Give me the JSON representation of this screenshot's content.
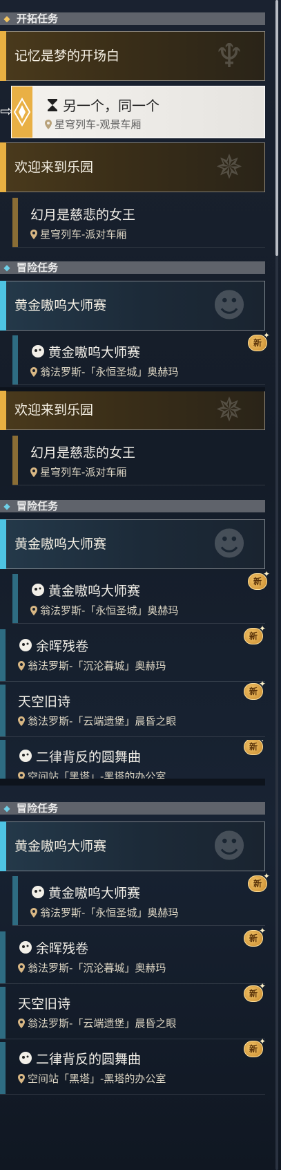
{
  "trailblaze": {
    "header": "开拓任务",
    "main_quest_1": "记忆是梦的开场白",
    "selected": {
      "title": "另一个，同一个",
      "location": "星穹列车-观景车厢"
    },
    "main_quest_2": "欢迎来到乐园",
    "sub_quest": {
      "title": "幻月是慈悲的女王",
      "location": "星穹列车-派对车厢"
    }
  },
  "adventure_1": {
    "header": "冒险任务",
    "group": "黄金嗷呜大师赛",
    "quest": {
      "title": "黄金嗷呜大师赛",
      "location": "翁法罗斯-「永恒圣城」奥赫玛",
      "badge": "新"
    }
  },
  "repeat_1": {
    "main_quest": "欢迎来到乐园",
    "sub_quest": {
      "title": "幻月是慈悲的女王",
      "location": "星穹列车-派对车厢"
    }
  },
  "adventure_2": {
    "header": "冒险任务",
    "group": "黄金嗷呜大师赛",
    "quests": [
      {
        "title": "黄金嗷呜大师赛",
        "location": "翁法罗斯-「永恒圣城」奥赫玛",
        "badge": "新"
      },
      {
        "title": "余晖残卷",
        "location": "翁法罗斯-「沉沦暮城」奥赫玛",
        "badge": "新"
      },
      {
        "title": "天空旧诗",
        "location": "翁法罗斯-「云端遗堡」晨昏之眼",
        "badge": "新"
      },
      {
        "title": "二律背反的圆舞曲",
        "location": "空间站「黑塔」-黑塔的办公室",
        "badge": "新"
      }
    ]
  },
  "adventure_3": {
    "header": "冒险任务",
    "group": "黄金嗷呜大师赛",
    "quests": [
      {
        "title": "黄金嗷呜大师赛",
        "location": "翁法罗斯-「永恒圣城」奥赫玛",
        "badge": "新"
      },
      {
        "title": "余晖残卷",
        "location": "翁法罗斯-「沉沦暮城」奥赫玛",
        "badge": "新"
      },
      {
        "title": "天空旧诗",
        "location": "翁法罗斯-「云端遗堡」晨昏之眼",
        "badge": "新"
      },
      {
        "title": "二律背反的圆舞曲",
        "location": "空间站「黑塔」-黑塔的办公室",
        "badge": "新"
      }
    ]
  },
  "colors": {
    "gold": "#e8b042",
    "blue": "#4ec4e4",
    "badge": "#e0a540"
  },
  "icons": {
    "section_trailblaze": "diamond-star-icon",
    "section_adventure": "diamond-star-icon",
    "location": "pin-icon",
    "quest_type": "mascot-icon",
    "hourglass": "hourglass-icon",
    "new": "new-badge-icon"
  }
}
